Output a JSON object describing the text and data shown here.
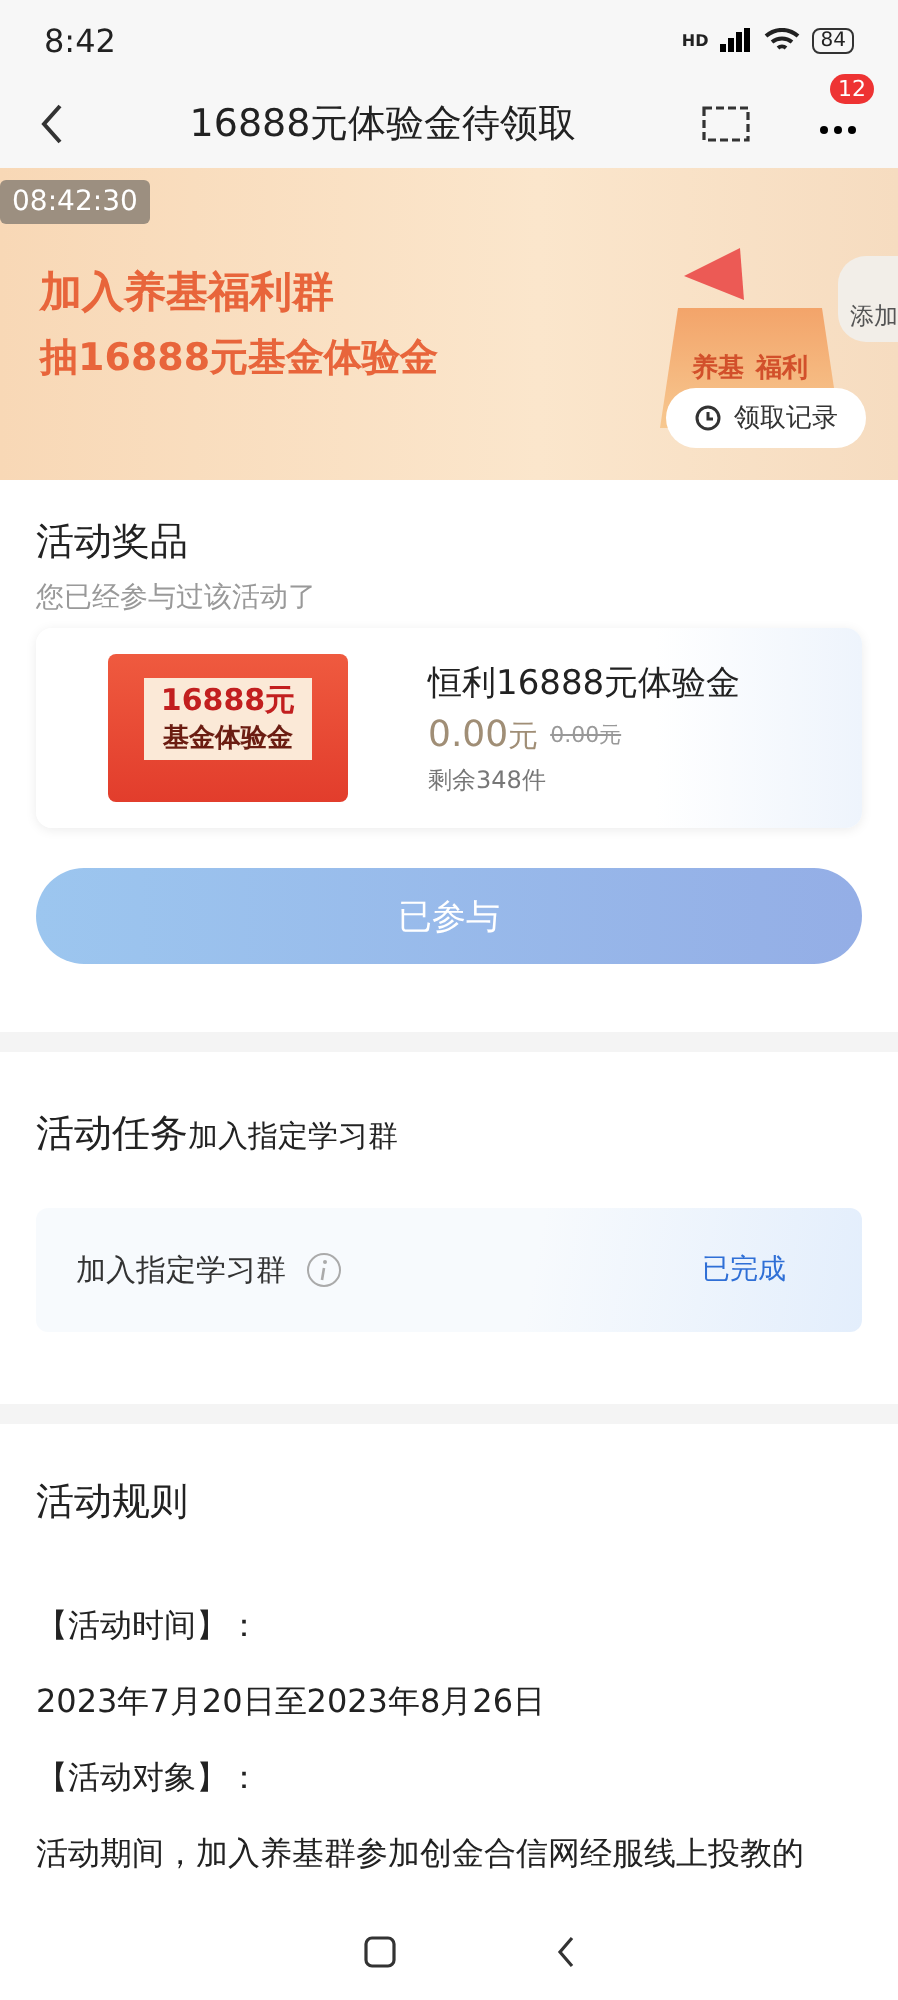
{
  "status_bar": {
    "time": "8:42",
    "network": "HD",
    "battery": "84"
  },
  "header": {
    "title": "16888元体验金待领取",
    "badge": "12"
  },
  "banner": {
    "timestamp": "08:42:30",
    "line1": "加入养基福利群",
    "line2": "抽16888元基金体验金",
    "sign": [
      "养基",
      "福利"
    ],
    "record_button": "领取记录",
    "float_button": "添加"
  },
  "prize": {
    "title": "活动奖品",
    "note": "您已经参与过该活动了",
    "image_lines": [
      "16888元",
      "基金体验金"
    ],
    "name": "恒利16888元体验金",
    "price": "0.00",
    "unit": "元",
    "original_price": "0.00元",
    "remaining": "剩余348件",
    "button": "已参与",
    "button_disabled": true
  },
  "task": {
    "title": "活动任务",
    "subtitle": "加入指定学习群",
    "items": [
      {
        "label": "加入指定学习群",
        "status": "已完成",
        "done": true
      }
    ]
  },
  "rules": {
    "title": "活动规则",
    "lines": [
      "【活动时间】：",
      "2023年7月20日至2023年8月26日",
      "【活动对象】：",
      "活动期间，加入养基群参加创金合信网经服线上投教的"
    ]
  }
}
